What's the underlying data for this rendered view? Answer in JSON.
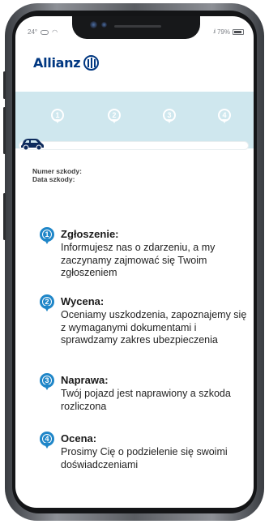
{
  "status_bar": {
    "temperature": "24°",
    "battery": "79%",
    "signal": ".ıl"
  },
  "header": {
    "brand": "Allianz"
  },
  "progress": {
    "steps": [
      "1",
      "2",
      "3",
      "4"
    ],
    "current_progress": 0
  },
  "claim": {
    "number_label": "Numer szkody:",
    "date_label": "Data szkody:"
  },
  "steps": [
    {
      "number": "1",
      "title": "Zgłoszenie:",
      "text": "Informujesz nas o zdarzeniu, a my zaczynamy zajmować się Twoim zgłoszeniem"
    },
    {
      "number": "2",
      "title": "Wycena:",
      "text": "Oceniamy uszkodzenia, zapoznajemy się z wymaganymi dokumentami i sprawdzamy zakres ubezpieczenia"
    },
    {
      "number": "3",
      "title": "Naprawa:",
      "text": "Twój pojazd jest naprawiony a szkoda rozliczona"
    },
    {
      "number": "4",
      "title": "Ocena:",
      "text": "Prosimy Cię o podzielenie się swoimi doświadczeniami"
    }
  ],
  "colors": {
    "brand_blue": "#003781",
    "accent_blue": "#1f86c8",
    "band": "#cfe7ee"
  }
}
